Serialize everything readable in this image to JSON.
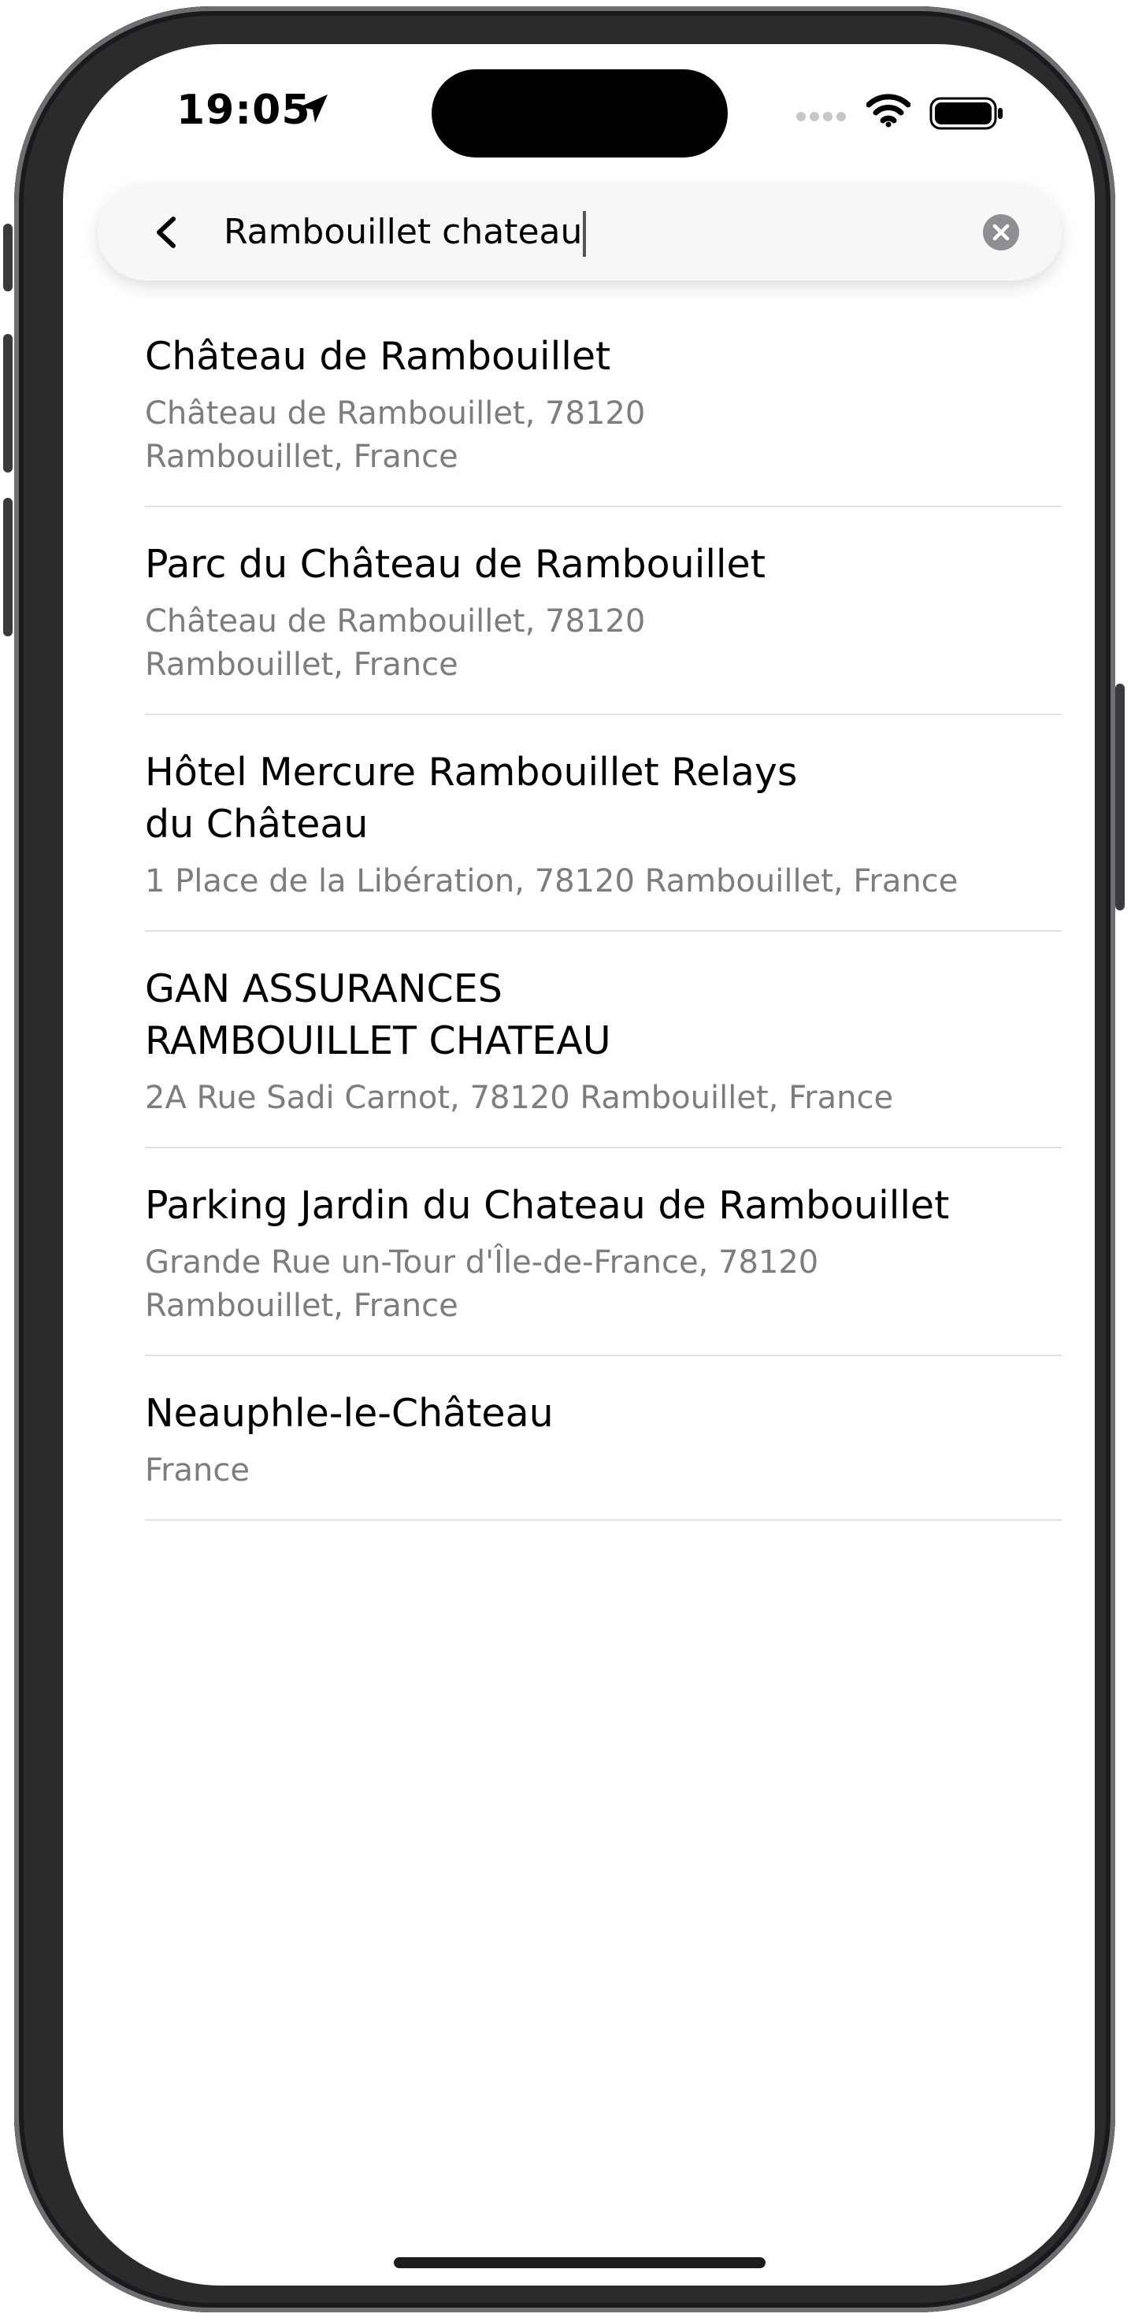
{
  "status_bar": {
    "time": "19:05",
    "icons": [
      "location-arrow-icon",
      "cellular-signal-icon",
      "wifi-icon",
      "battery-icon"
    ]
  },
  "search": {
    "query": "Rambouillet chateau",
    "back_icon": "chevron-left-icon",
    "clear_icon": "clear-circle-icon"
  },
  "results": [
    {
      "title": "Château de Rambouillet",
      "address": "Château de Rambouillet, 78120\nRambouillet, France"
    },
    {
      "title": "Parc du Château de Rambouillet",
      "address": "Château de Rambouillet, 78120\nRambouillet, France"
    },
    {
      "title": "Hôtel Mercure Rambouillet Relays\ndu Château",
      "address": "1 Place de la Libération, 78120 Rambouillet, France"
    },
    {
      "title": "GAN ASSURANCES\nRAMBOUILLET CHATEAU",
      "address": "2A Rue Sadi Carnot, 78120 Rambouillet, France"
    },
    {
      "title": "Parking Jardin du Chateau de Rambouillet",
      "address": "Grande Rue un-Tour d'Île-de-France, 78120\nRambouillet, France"
    },
    {
      "title": "Neauphle-le-Château",
      "address": "France"
    }
  ],
  "colors": {
    "title_text": "#000000",
    "address_text": "#7d7d7d",
    "divider": "#e0e0e0",
    "search_bg": "#f7f7f7"
  }
}
